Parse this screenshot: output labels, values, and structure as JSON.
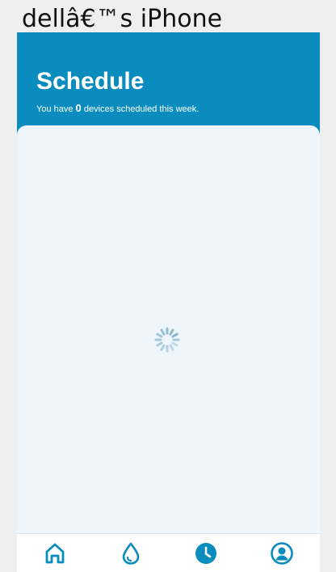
{
  "device": {
    "name": "dellâ€™s iPhone"
  },
  "header": {
    "title": "Schedule",
    "subtitle_prefix": "You have",
    "scheduled_count": "0",
    "subtitle_suffix": "devices scheduled this week."
  },
  "content": {
    "loading_indicator": "spinner-icon"
  },
  "tabbar": {
    "tabs": [
      {
        "icon": "home-icon",
        "active": false
      },
      {
        "icon": "water-drop-icon",
        "active": false
      },
      {
        "icon": "clock-icon",
        "active": true
      },
      {
        "icon": "profile-icon",
        "active": false
      }
    ]
  },
  "colors": {
    "brand_blue": "#0a8dbe",
    "content_bg": "#eef6fb",
    "tab_icon": "#0a8dbe",
    "spinner": "#7fb3c8"
  }
}
